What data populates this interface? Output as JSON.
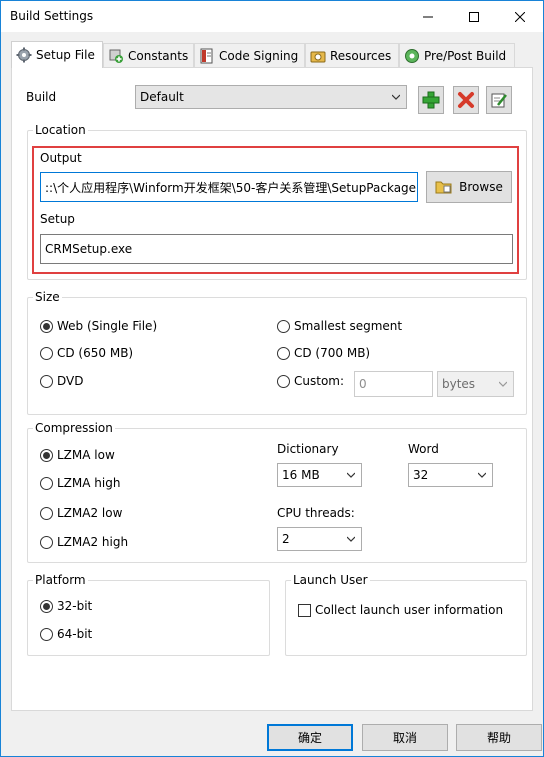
{
  "window": {
    "title": "Build Settings"
  },
  "tabs": [
    {
      "label": "Setup File",
      "icon": "gear-icon",
      "active": true
    },
    {
      "label": "Constants",
      "icon": "constants-icon",
      "active": false
    },
    {
      "label": "Code Signing",
      "icon": "certificate-icon",
      "active": false
    },
    {
      "label": "Resources",
      "icon": "resources-icon",
      "active": false
    },
    {
      "label": "Pre/Post Build",
      "icon": "build-icon",
      "active": false
    }
  ],
  "build": {
    "label": "Build",
    "value": "Default",
    "add_icon": "add-icon",
    "delete_icon": "delete-icon",
    "edit_icon": "edit-icon"
  },
  "location": {
    "title": "Location",
    "output_label": "Output",
    "output_value": "::\\个人应用程序\\Winform开发框架\\50-客户关系管理\\SetupPackage",
    "browse_label": "Browse",
    "setup_label": "Setup",
    "setup_value": "CRMSetup.exe"
  },
  "size": {
    "title": "Size",
    "options": [
      {
        "label": "Web (Single File)",
        "checked": true
      },
      {
        "label": "CD (650 MB)",
        "checked": false
      },
      {
        "label": "DVD",
        "checked": false
      },
      {
        "label": "Smallest segment",
        "checked": false
      },
      {
        "label": "CD (700 MB)",
        "checked": false
      },
      {
        "label": "Custom:",
        "checked": false
      }
    ],
    "custom_value": "0",
    "custom_unit": "bytes"
  },
  "compression": {
    "title": "Compression",
    "options": [
      {
        "label": "LZMA low",
        "checked": true
      },
      {
        "label": "LZMA high",
        "checked": false
      },
      {
        "label": "LZMA2 low",
        "checked": false
      },
      {
        "label": "LZMA2 high",
        "checked": false
      }
    ],
    "dictionary_label": "Dictionary",
    "dictionary_value": "16 MB",
    "word_label": "Word",
    "word_value": "32",
    "cpu_label": "CPU threads:",
    "cpu_value": "2"
  },
  "platform": {
    "title": "Platform",
    "options": [
      {
        "label": "32-bit",
        "checked": true
      },
      {
        "label": "64-bit",
        "checked": false
      }
    ]
  },
  "launch_user": {
    "title": "Launch User",
    "checkbox_label": "Collect launch user information",
    "checked": false
  },
  "footer": {
    "ok_label": "确定",
    "cancel_label": "取消",
    "help_label": "帮助"
  },
  "colors": {
    "accent": "#0078d7",
    "highlight": "#e04040",
    "window_border": "#1883d7"
  }
}
